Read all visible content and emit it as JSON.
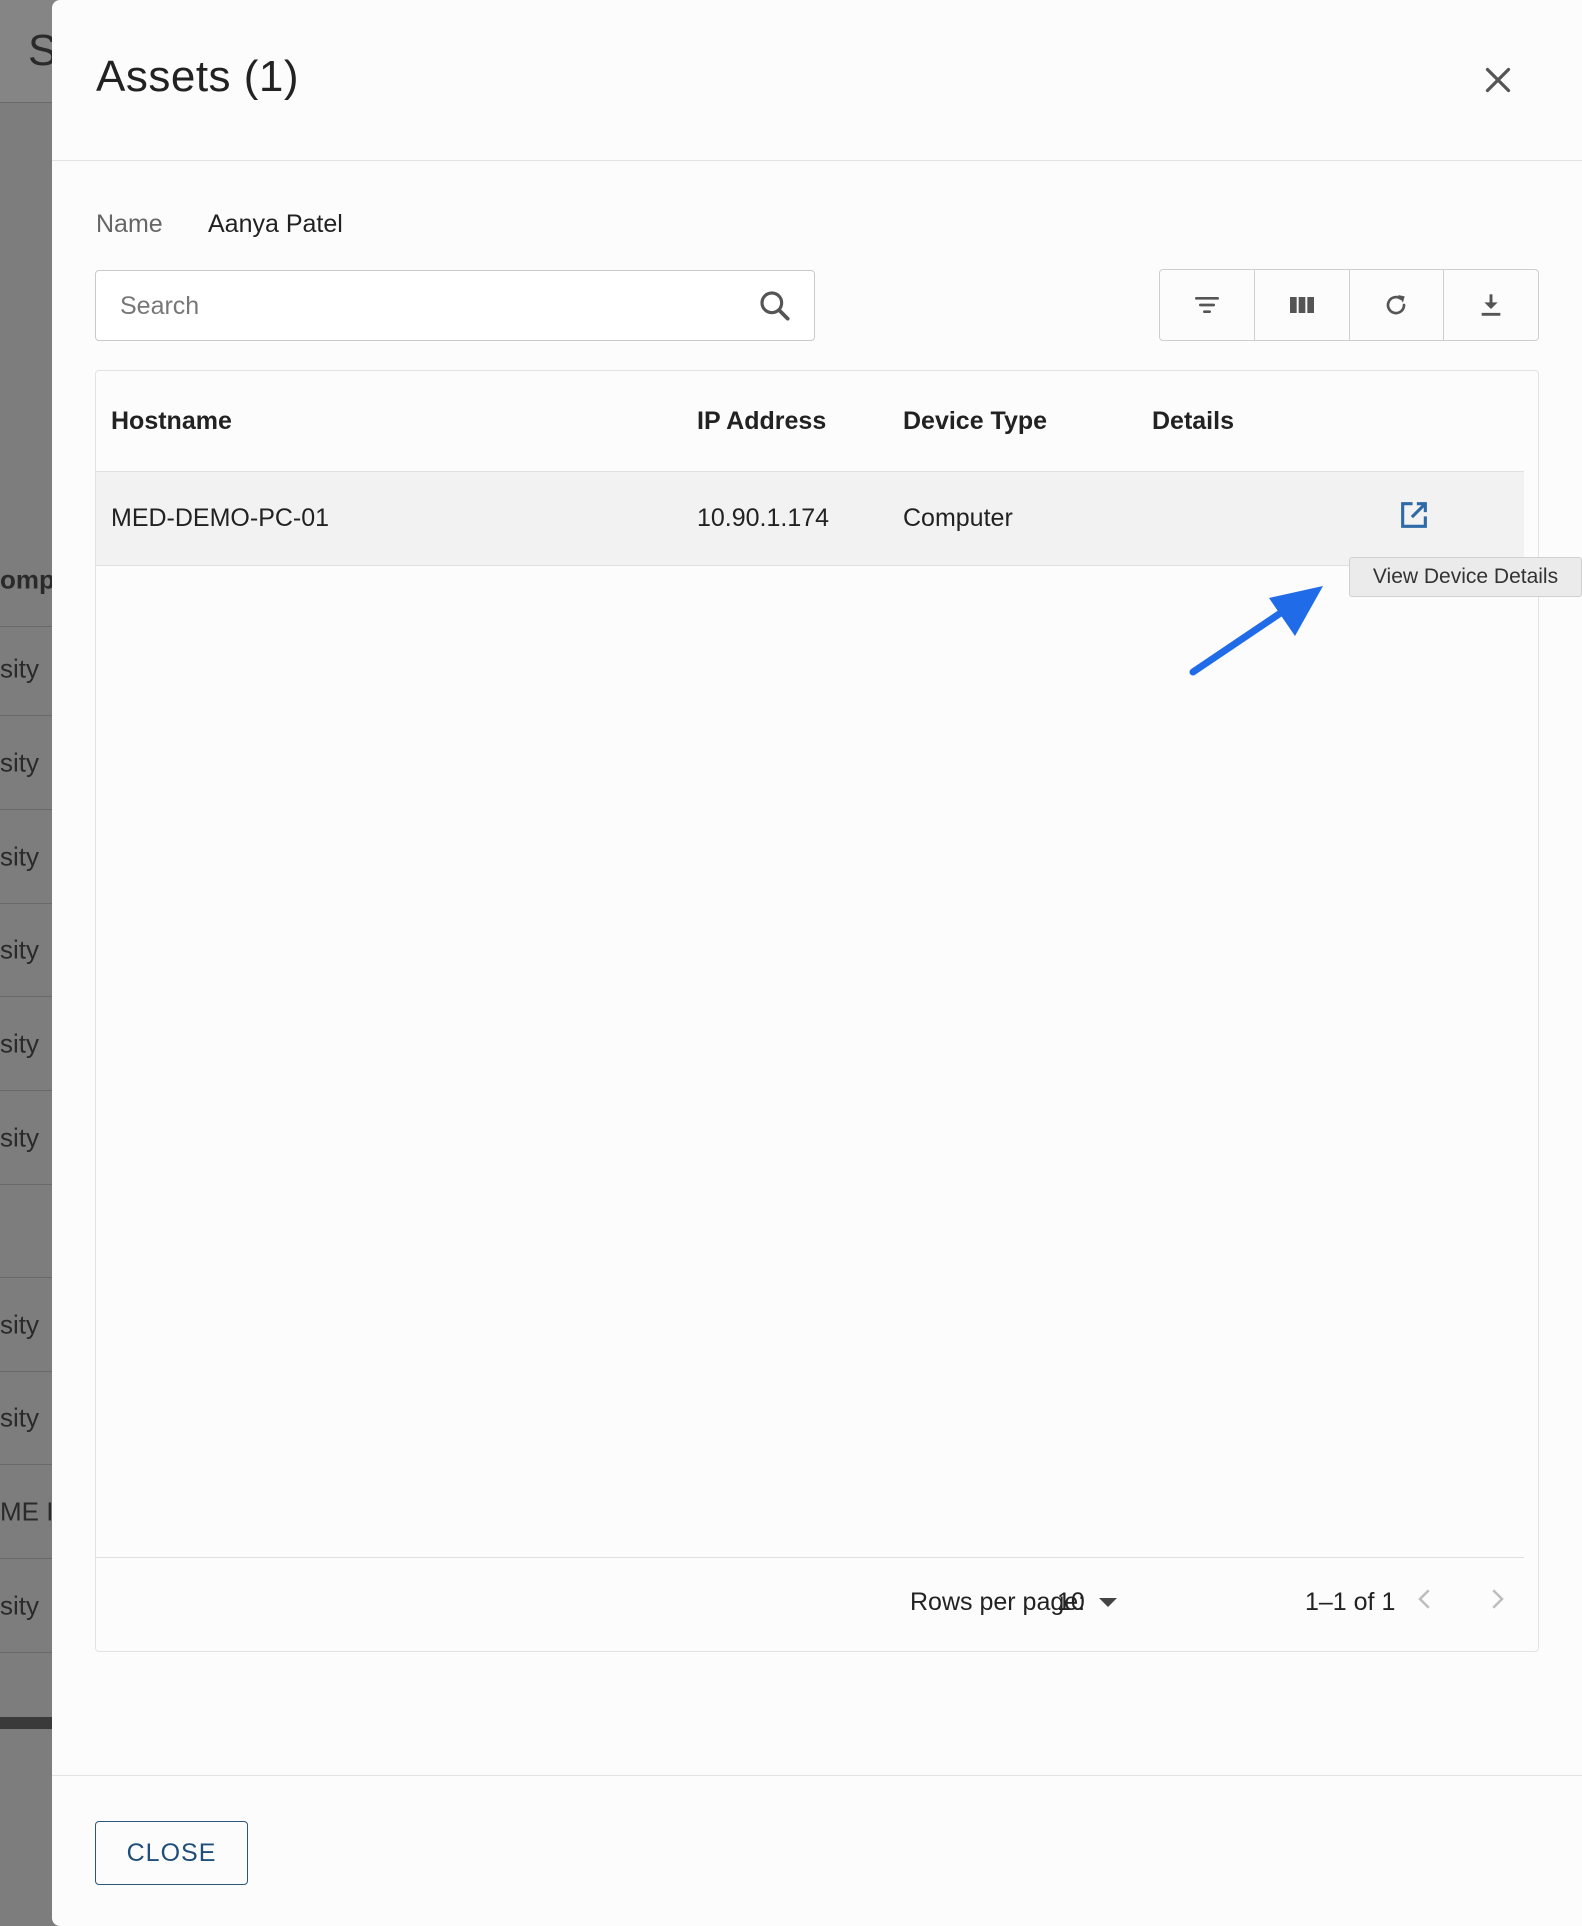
{
  "background": {
    "topbar_letter": "S",
    "rows": [
      {
        "text": "ompa",
        "header": true
      },
      {
        "text": "sity"
      },
      {
        "text": "sity"
      },
      {
        "text": "sity"
      },
      {
        "text": "sity"
      },
      {
        "text": "sity"
      },
      {
        "text": "sity"
      },
      {
        "text": ""
      },
      {
        "text": "sity"
      },
      {
        "text": "sity"
      },
      {
        "text": "ME I"
      },
      {
        "text": "sity"
      }
    ]
  },
  "dialog": {
    "title": "Assets (1)",
    "close_icon": "close-icon"
  },
  "name_row": {
    "label": "Name",
    "value": "Aanya Patel"
  },
  "search": {
    "placeholder": "Search",
    "value": "",
    "icon": "search-icon"
  },
  "toolbar": {
    "buttons": [
      {
        "name": "filter-button",
        "icon": "filter-icon"
      },
      {
        "name": "columns-button",
        "icon": "columns-icon"
      },
      {
        "name": "refresh-button",
        "icon": "refresh-icon"
      },
      {
        "name": "download-button",
        "icon": "download-icon"
      }
    ]
  },
  "table": {
    "columns": [
      "Hostname",
      "IP Address",
      "Device Type",
      "Details"
    ],
    "rows": [
      {
        "hostname": "MED-DEMO-PC-01",
        "ip": "10.90.1.174",
        "device_type": "Computer",
        "details_icon": "open-in-new-icon"
      }
    ]
  },
  "pagination": {
    "rows_per_page_label": "Rows per page:",
    "rows_per_page_value": "10",
    "range": "1–1 of 1"
  },
  "tooltip": {
    "text": "View Device Details"
  },
  "annotation": {
    "arrow_color": "#1f6be8"
  },
  "footer": {
    "close_label": "CLOSE"
  },
  "colors": {
    "accent": "#2e6aa8",
    "close_button_text": "#1f4e79"
  }
}
